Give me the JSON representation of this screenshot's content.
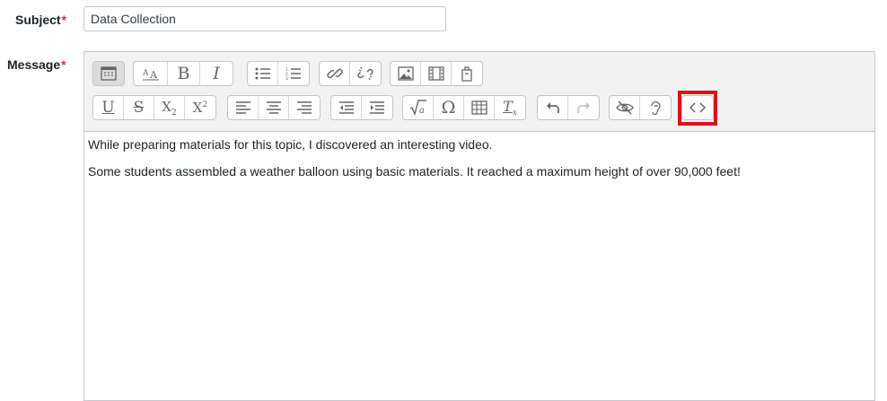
{
  "form": {
    "subject": {
      "label": "Subject",
      "required_marker": "*",
      "value": "Data Collection"
    },
    "message": {
      "label": "Message",
      "required_marker": "*"
    }
  },
  "toolbar": {
    "row1": [
      {
        "name": "toolbar-toggle-button",
        "icon": "toolbar-toggle-icon",
        "pressed": true
      },
      {
        "name": "font-style-button",
        "icon": "font-size-icon",
        "glyph": "A"
      },
      {
        "name": "bold-button",
        "icon": "bold-icon",
        "glyph": "B"
      },
      {
        "name": "italic-button",
        "icon": "italic-icon",
        "glyph": "I"
      },
      {
        "name": "unordered-list-button",
        "icon": "bullet-list-icon"
      },
      {
        "name": "ordered-list-button",
        "icon": "numbered-list-icon"
      },
      {
        "name": "link-button",
        "icon": "link-icon"
      },
      {
        "name": "unlink-button",
        "icon": "unlink-icon"
      },
      {
        "name": "insert-image-button",
        "icon": "image-icon"
      },
      {
        "name": "insert-media-button",
        "icon": "film-icon"
      },
      {
        "name": "manage-files-button",
        "icon": "file-manager-icon"
      }
    ],
    "row2": [
      {
        "name": "underline-button",
        "icon": "underline-icon",
        "glyph": "U"
      },
      {
        "name": "strikethrough-button",
        "icon": "strikethrough-icon",
        "glyph": "S"
      },
      {
        "name": "subscript-button",
        "icon": "subscript-icon",
        "glyph": "X",
        "sub": "2"
      },
      {
        "name": "superscript-button",
        "icon": "superscript-icon",
        "glyph": "X",
        "sup": "2"
      },
      {
        "name": "align-left-button",
        "icon": "align-left-icon"
      },
      {
        "name": "align-center-button",
        "icon": "align-center-icon"
      },
      {
        "name": "align-right-button",
        "icon": "align-right-icon"
      },
      {
        "name": "outdent-button",
        "icon": "outdent-icon"
      },
      {
        "name": "indent-button",
        "icon": "indent-icon"
      },
      {
        "name": "equation-button",
        "icon": "square-root-icon",
        "glyph": "a"
      },
      {
        "name": "special-character-button",
        "icon": "omega-icon",
        "glyph": "Ω"
      },
      {
        "name": "table-button",
        "icon": "table-icon"
      },
      {
        "name": "clear-formatting-button",
        "icon": "clear-formatting-icon",
        "glyph": "T",
        "sub": "x"
      },
      {
        "name": "undo-button",
        "icon": "undo-icon"
      },
      {
        "name": "redo-button",
        "icon": "redo-icon",
        "disabled": true
      },
      {
        "name": "accessibility-checker-button",
        "icon": "eye-slash-icon"
      },
      {
        "name": "screenreader-helper-button",
        "icon": "ear-icon"
      },
      {
        "name": "html-source-button",
        "icon": "code-brackets-icon"
      }
    ],
    "highlight_color": "#dd1219"
  },
  "content": {
    "paragraphs": [
      "While preparing materials for this topic, I discovered an interesting video.",
      "Some students assembled a weather balloon using basic materials.  It reached a maximum height of over 90,000 feet!"
    ]
  }
}
